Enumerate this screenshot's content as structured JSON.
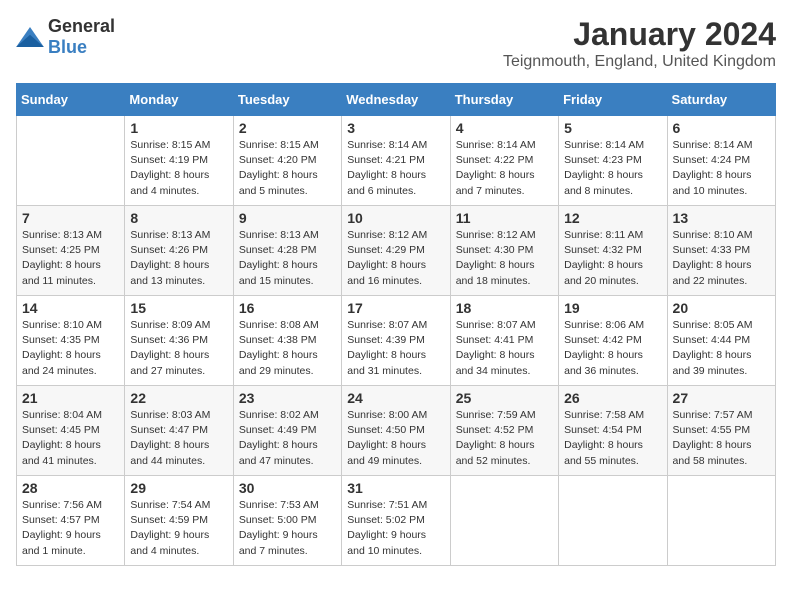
{
  "header": {
    "logo_general": "General",
    "logo_blue": "Blue",
    "month": "January 2024",
    "location": "Teignmouth, England, United Kingdom"
  },
  "days_of_week": [
    "Sunday",
    "Monday",
    "Tuesday",
    "Wednesday",
    "Thursday",
    "Friday",
    "Saturday"
  ],
  "weeks": [
    [
      {
        "day": "",
        "info": ""
      },
      {
        "day": "1",
        "info": "Sunrise: 8:15 AM\nSunset: 4:19 PM\nDaylight: 8 hours\nand 4 minutes."
      },
      {
        "day": "2",
        "info": "Sunrise: 8:15 AM\nSunset: 4:20 PM\nDaylight: 8 hours\nand 5 minutes."
      },
      {
        "day": "3",
        "info": "Sunrise: 8:14 AM\nSunset: 4:21 PM\nDaylight: 8 hours\nand 6 minutes."
      },
      {
        "day": "4",
        "info": "Sunrise: 8:14 AM\nSunset: 4:22 PM\nDaylight: 8 hours\nand 7 minutes."
      },
      {
        "day": "5",
        "info": "Sunrise: 8:14 AM\nSunset: 4:23 PM\nDaylight: 8 hours\nand 8 minutes."
      },
      {
        "day": "6",
        "info": "Sunrise: 8:14 AM\nSunset: 4:24 PM\nDaylight: 8 hours\nand 10 minutes."
      }
    ],
    [
      {
        "day": "7",
        "info": "Sunrise: 8:13 AM\nSunset: 4:25 PM\nDaylight: 8 hours\nand 11 minutes."
      },
      {
        "day": "8",
        "info": "Sunrise: 8:13 AM\nSunset: 4:26 PM\nDaylight: 8 hours\nand 13 minutes."
      },
      {
        "day": "9",
        "info": "Sunrise: 8:13 AM\nSunset: 4:28 PM\nDaylight: 8 hours\nand 15 minutes."
      },
      {
        "day": "10",
        "info": "Sunrise: 8:12 AM\nSunset: 4:29 PM\nDaylight: 8 hours\nand 16 minutes."
      },
      {
        "day": "11",
        "info": "Sunrise: 8:12 AM\nSunset: 4:30 PM\nDaylight: 8 hours\nand 18 minutes."
      },
      {
        "day": "12",
        "info": "Sunrise: 8:11 AM\nSunset: 4:32 PM\nDaylight: 8 hours\nand 20 minutes."
      },
      {
        "day": "13",
        "info": "Sunrise: 8:10 AM\nSunset: 4:33 PM\nDaylight: 8 hours\nand 22 minutes."
      }
    ],
    [
      {
        "day": "14",
        "info": "Sunrise: 8:10 AM\nSunset: 4:35 PM\nDaylight: 8 hours\nand 24 minutes."
      },
      {
        "day": "15",
        "info": "Sunrise: 8:09 AM\nSunset: 4:36 PM\nDaylight: 8 hours\nand 27 minutes."
      },
      {
        "day": "16",
        "info": "Sunrise: 8:08 AM\nSunset: 4:38 PM\nDaylight: 8 hours\nand 29 minutes."
      },
      {
        "day": "17",
        "info": "Sunrise: 8:07 AM\nSunset: 4:39 PM\nDaylight: 8 hours\nand 31 minutes."
      },
      {
        "day": "18",
        "info": "Sunrise: 8:07 AM\nSunset: 4:41 PM\nDaylight: 8 hours\nand 34 minutes."
      },
      {
        "day": "19",
        "info": "Sunrise: 8:06 AM\nSunset: 4:42 PM\nDaylight: 8 hours\nand 36 minutes."
      },
      {
        "day": "20",
        "info": "Sunrise: 8:05 AM\nSunset: 4:44 PM\nDaylight: 8 hours\nand 39 minutes."
      }
    ],
    [
      {
        "day": "21",
        "info": "Sunrise: 8:04 AM\nSunset: 4:45 PM\nDaylight: 8 hours\nand 41 minutes."
      },
      {
        "day": "22",
        "info": "Sunrise: 8:03 AM\nSunset: 4:47 PM\nDaylight: 8 hours\nand 44 minutes."
      },
      {
        "day": "23",
        "info": "Sunrise: 8:02 AM\nSunset: 4:49 PM\nDaylight: 8 hours\nand 47 minutes."
      },
      {
        "day": "24",
        "info": "Sunrise: 8:00 AM\nSunset: 4:50 PM\nDaylight: 8 hours\nand 49 minutes."
      },
      {
        "day": "25",
        "info": "Sunrise: 7:59 AM\nSunset: 4:52 PM\nDaylight: 8 hours\nand 52 minutes."
      },
      {
        "day": "26",
        "info": "Sunrise: 7:58 AM\nSunset: 4:54 PM\nDaylight: 8 hours\nand 55 minutes."
      },
      {
        "day": "27",
        "info": "Sunrise: 7:57 AM\nSunset: 4:55 PM\nDaylight: 8 hours\nand 58 minutes."
      }
    ],
    [
      {
        "day": "28",
        "info": "Sunrise: 7:56 AM\nSunset: 4:57 PM\nDaylight: 9 hours\nand 1 minute."
      },
      {
        "day": "29",
        "info": "Sunrise: 7:54 AM\nSunset: 4:59 PM\nDaylight: 9 hours\nand 4 minutes."
      },
      {
        "day": "30",
        "info": "Sunrise: 7:53 AM\nSunset: 5:00 PM\nDaylight: 9 hours\nand 7 minutes."
      },
      {
        "day": "31",
        "info": "Sunrise: 7:51 AM\nSunset: 5:02 PM\nDaylight: 9 hours\nand 10 minutes."
      },
      {
        "day": "",
        "info": ""
      },
      {
        "day": "",
        "info": ""
      },
      {
        "day": "",
        "info": ""
      }
    ]
  ]
}
